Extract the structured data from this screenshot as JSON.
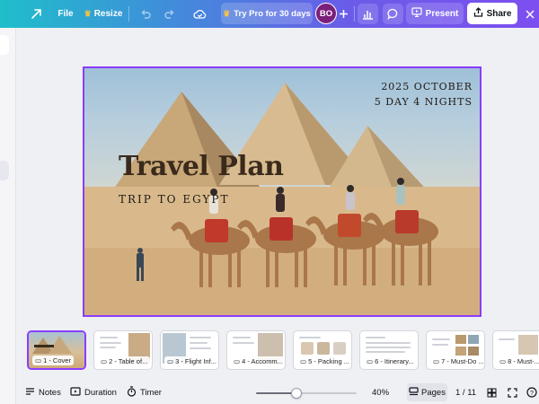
{
  "topbar": {
    "file_label": "File",
    "resize_label": "Resize",
    "pro_label": "Try Pro for 30 days",
    "avatar_initials": "BO",
    "present_label": "Present",
    "share_label": "Share",
    "icons": [
      "home-icon",
      "crown-icon",
      "undo-icon",
      "redo-icon",
      "cloud-save-icon",
      "plus-icon",
      "chart-icon",
      "comment-icon",
      "present-icon",
      "share-icon",
      "close-icon"
    ]
  },
  "slide": {
    "date_line1": "2025 OCTOBER",
    "date_line2": "5 DAY 4 NIGHTS",
    "title": "Travel Plan",
    "subtitle": "TRIP TO EGYPT",
    "accent_color": "#8b3dff"
  },
  "thumbnails": [
    {
      "label": "1 - Cover"
    },
    {
      "label": "2 - Table of..."
    },
    {
      "label": "3 - Flight Inf..."
    },
    {
      "label": "4 - Accomm..."
    },
    {
      "label": "5 - Packing ..."
    },
    {
      "label": "6 - Itinerary..."
    },
    {
      "label": "7 - Must-Do ..."
    },
    {
      "label": "8 - Must-..."
    }
  ],
  "bottombar": {
    "notes_label": "Notes",
    "duration_label": "Duration",
    "timer_label": "Timer",
    "zoom_value": "40%",
    "zoom_fraction": 0.4,
    "pages_label": "Pages",
    "page_count": "1 / 11"
  }
}
